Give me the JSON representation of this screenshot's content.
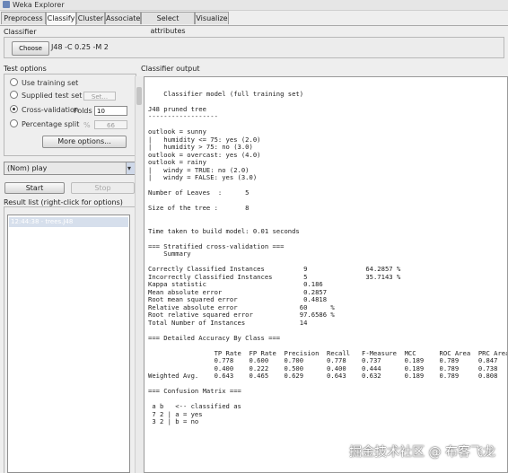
{
  "window": {
    "title": "Weka Explorer"
  },
  "tabs": [
    {
      "label": "Preprocess",
      "active": false
    },
    {
      "label": "Classify",
      "active": true
    },
    {
      "label": "Cluster",
      "active": false
    },
    {
      "label": "Associate",
      "active": false
    },
    {
      "label": "Select attributes",
      "active": false
    },
    {
      "label": "Visualize",
      "active": false
    }
  ],
  "classifier": {
    "section_label": "Classifier",
    "choose_label": "Choose",
    "spec": "J48 -C 0.25 -M 2"
  },
  "test_options": {
    "section_label": "Test options",
    "use_training": "Use training set",
    "supplied_test": "Supplied test set",
    "set_label": "Set...",
    "cross_validation": "Cross-validation",
    "folds_label": "Folds",
    "folds_value": "10",
    "percentage_split": "Percentage split",
    "percent_sign": "%",
    "percent_value": "66",
    "more_options": "More options..."
  },
  "class_select": {
    "value": "(Nom) play"
  },
  "controls": {
    "start": "Start",
    "stop": "Stop"
  },
  "result_list": {
    "label": "Result list (right-click for options)",
    "items": [
      "12:44:38 - trees.J48"
    ]
  },
  "output": {
    "label": "Classifier output",
    "text": "\n    Classifier model (full training set)\n\nJ48 pruned tree\n------------------\n\noutlook = sunny\n|   humidity <= 75: yes (2.0)\n|   humidity > 75: no (3.0)\noutlook = overcast: yes (4.0)\noutlook = rainy\n|   windy = TRUE: no (2.0)\n|   windy = FALSE: yes (3.0)\n\nNumber of Leaves  :      5\n\nSize of the tree :       8\n\n\nTime taken to build model: 0.01 seconds\n\n=== Stratified cross-validation ===\n    Summary\n\nCorrectly Classified Instances          9               64.2857 %\nIncorrectly Classified Instances        5               35.7143 %\nKappa statistic                         0.186\nMean absolute error                     0.2857\nRoot mean squared error                 0.4818\nRelative absolute error                60      %\nRoot relative squared error            97.6586 %\nTotal Number of Instances              14\n\n=== Detailed Accuracy By Class ===\n\n                 TP Rate  FP Rate  Precision  Recall   F-Measure  MCC      ROC Area  PRC Area  Class\n                 0.778    0.600    0.700      0.778    0.737      0.189    0.789     0.847     yes\n                 0.400    0.222    0.500      0.400    0.444      0.189    0.789     0.738     no\nWeighted Avg.    0.643    0.465    0.629      0.643    0.632      0.189    0.789     0.808\n\n=== Confusion Matrix ===\n\n a b   <-- classified as\n 7 2 | a = yes\n 3 2 | b = no"
  },
  "watermark": "掘金技术社区 @ 布客飞龙",
  "colors": {
    "selection": "#d6dfec",
    "accent_arrow": "#cfd8e8"
  }
}
